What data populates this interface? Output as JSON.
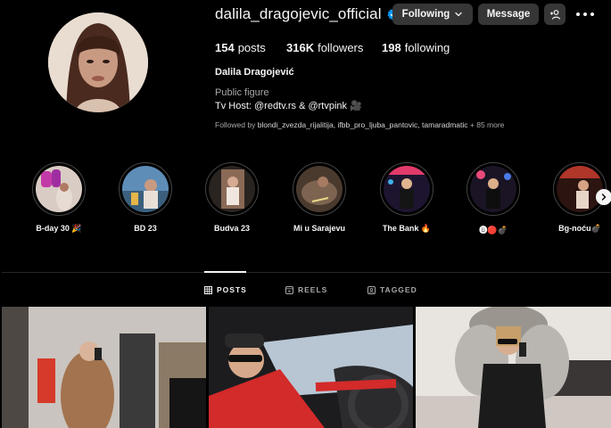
{
  "profile": {
    "username": "dalila_dragojevic_official",
    "full_name": "Dalila Dragojević",
    "category": "Public figure",
    "bio": "Tv Host: @redtv.rs & @rtvpink 🎥",
    "followed_by_prefix": "Followed by",
    "followed_by_names": "blondi_zvezda_rijalitija, ifbb_pro_ljuba_pantovic, tamaradmatic",
    "followed_by_more": "+ 85 more"
  },
  "buttons": {
    "following": "Following",
    "message": "Message"
  },
  "stats": {
    "posts_count": "154",
    "posts_label": "posts",
    "followers_count": "316K",
    "followers_label": "followers",
    "following_count": "198",
    "following_label": "following"
  },
  "highlights": [
    {
      "label": "B-day 30 🎉"
    },
    {
      "label": "BD 23"
    },
    {
      "label": "Budva 23"
    },
    {
      "label": "Mi u Sarajevu"
    },
    {
      "label": "The Bank 🔥"
    },
    {
      "label": "🅑🔴💣"
    },
    {
      "label": "Bg-noću💣"
    }
  ],
  "tabs": [
    {
      "label": "POSTS",
      "active": true
    },
    {
      "label": "REELS",
      "active": false
    },
    {
      "label": "TAGGED",
      "active": false
    }
  ],
  "colors": {
    "background": "#000000",
    "button_bg": "#363636",
    "verified_blue": "#0095f6",
    "muted_text": "#a8a8a8"
  }
}
